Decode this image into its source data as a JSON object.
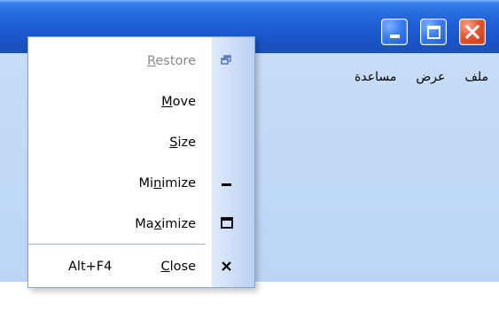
{
  "menubar": {
    "items": [
      "ملف",
      "عرض",
      "مساعدة"
    ]
  },
  "window_controls": {
    "minimize": "minimize",
    "maximize": "maximize",
    "close": "close"
  },
  "system_menu": {
    "items": [
      {
        "label": "Restore",
        "mnemonic_index": 0,
        "enabled": false,
        "icon": "restore-icon"
      },
      {
        "label": "Move",
        "mnemonic_index": 0,
        "enabled": true,
        "icon": ""
      },
      {
        "label": "Size",
        "mnemonic_index": 0,
        "enabled": true,
        "icon": ""
      },
      {
        "label": "Minimize",
        "mnemonic_index": 2,
        "enabled": true,
        "icon": "minimize-icon"
      },
      {
        "label": "Maximize",
        "mnemonic_index": 2,
        "enabled": true,
        "icon": "maximize-icon"
      },
      {
        "label": "Close",
        "mnemonic_index": 0,
        "enabled": true,
        "icon": "close-icon",
        "shortcut": "Alt+F4"
      }
    ]
  },
  "colors": {
    "titlebar": "#1f5fd6",
    "client_bg": "#c3daf7",
    "menu_icon_band": "#c9dbf5",
    "close_button": "#e2562f",
    "disabled_text": "#8a8a8a"
  }
}
